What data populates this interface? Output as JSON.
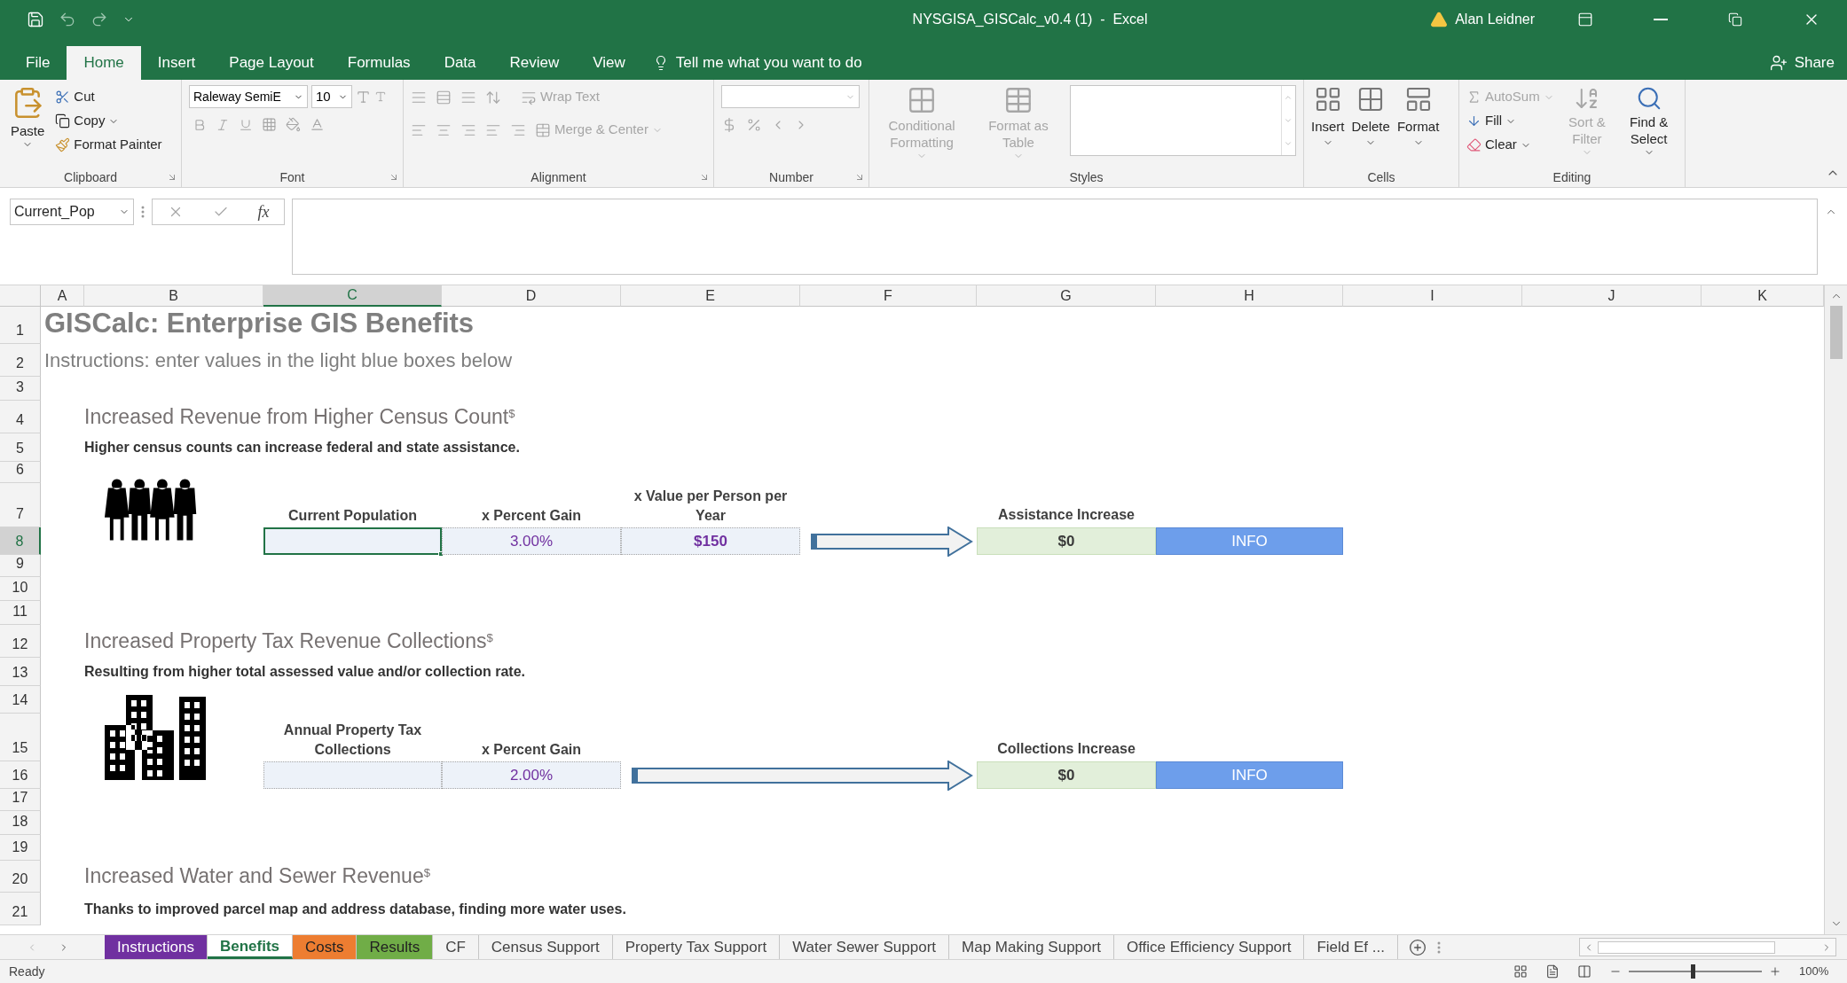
{
  "window": {
    "title": "NYSGISA_GISCalc_v0.4 (1)  -  Excel",
    "user": "Alan Leidner"
  },
  "menu_tabs": [
    {
      "label": "File",
      "selected": false
    },
    {
      "label": "Home",
      "selected": true
    },
    {
      "label": "Insert",
      "selected": false
    },
    {
      "label": "Page Layout",
      "selected": false
    },
    {
      "label": "Formulas",
      "selected": false
    },
    {
      "label": "Data",
      "selected": false
    },
    {
      "label": "Review",
      "selected": false
    },
    {
      "label": "View",
      "selected": false
    }
  ],
  "tell_me": "Tell me what you want to do",
  "share": "Share",
  "ribbon": {
    "clipboard": {
      "label": "Clipboard",
      "paste": "Paste",
      "cut": "Cut",
      "copy": "Copy",
      "format_painter": "Format Painter"
    },
    "font": {
      "label": "Font",
      "font_name": "Raleway SemiE",
      "font_size": "10"
    },
    "alignment": {
      "label": "Alignment",
      "wrap_text": {
        "label": "Wrap Text",
        "disabled": true
      },
      "merge": {
        "label": "Merge & Center",
        "disabled": true
      }
    },
    "number": {
      "label": "Number"
    },
    "styles": {
      "label": "Styles",
      "conditional": {
        "label": "Conditional Formatting",
        "disabled": true
      },
      "format_table": {
        "label": "Format as Table",
        "disabled": true
      }
    },
    "cells": {
      "label": "Cells",
      "buttons": [
        {
          "label": "Insert",
          "disabled": false
        },
        {
          "label": "Delete",
          "disabled": false
        },
        {
          "label": "Format",
          "disabled": false
        }
      ]
    },
    "editing": {
      "label": "Editing",
      "autosum": {
        "label": "AutoSum",
        "disabled": true
      },
      "fill": {
        "label": "Fill",
        "disabled": false
      },
      "clear": {
        "label": "Clear",
        "disabled": false
      },
      "sort": {
        "label": "Sort & Filter",
        "disabled": true
      },
      "find": {
        "label": "Find & Select",
        "disabled": false
      }
    }
  },
  "formula_bar": {
    "name_box": "Current_Pop",
    "function_button": "fx"
  },
  "columns": [
    {
      "label": "A",
      "selected": false
    },
    {
      "label": "B",
      "selected": false
    },
    {
      "label": "C",
      "selected": true
    },
    {
      "label": "D",
      "selected": false
    },
    {
      "label": "E",
      "selected": false
    },
    {
      "label": "F",
      "selected": false
    },
    {
      "label": "G",
      "selected": false
    },
    {
      "label": "H",
      "selected": false
    },
    {
      "label": "I",
      "selected": false
    },
    {
      "label": "J",
      "selected": false
    },
    {
      "label": "K",
      "selected": false
    }
  ],
  "rows": [
    {
      "label": "1",
      "selected": false
    },
    {
      "label": "2",
      "selected": false
    },
    {
      "label": "3",
      "selected": false
    },
    {
      "label": "4",
      "selected": false
    },
    {
      "label": "5",
      "selected": false
    },
    {
      "label": "6",
      "selected": false
    },
    {
      "label": "7",
      "selected": false
    },
    {
      "label": "8",
      "selected": true
    },
    {
      "label": "9",
      "selected": false
    },
    {
      "label": "10",
      "selected": false
    },
    {
      "label": "11",
      "selected": false
    },
    {
      "label": "12",
      "selected": false
    },
    {
      "label": "13",
      "selected": false
    },
    {
      "label": "14",
      "selected": false
    },
    {
      "label": "15",
      "selected": false
    },
    {
      "label": "16",
      "selected": false
    },
    {
      "label": "17",
      "selected": false
    },
    {
      "label": "18",
      "selected": false
    },
    {
      "label": "19",
      "selected": false
    },
    {
      "label": "20",
      "selected": false
    },
    {
      "label": "21",
      "selected": false
    }
  ],
  "sheet": {
    "title": "GISCalc: Enterprise GIS Benefits",
    "instructions": "Instructions: enter values in the light blue boxes below",
    "blocks": [
      {
        "kind": "people",
        "heading": "Increased Revenue from Higher Census Count",
        "mark": "$",
        "description": "Higher census counts can increase federal and state assistance.",
        "inputs": [
          {
            "label": "Current Population",
            "selected": true
          },
          {
            "label": "x Percent Gain",
            "value": "3.00%",
            "kind": "percent",
            "selected": false
          },
          {
            "label": "x Value per Person per Year",
            "value": "$150",
            "kind": "currency",
            "selected": false
          }
        ],
        "result": {
          "label": "Assistance Increase",
          "value": "$0"
        },
        "info": "INFO"
      },
      {
        "kind": "buildings",
        "heading": "Increased Property Tax Revenue Collections",
        "mark": "$",
        "description": "Resulting from higher total assessed value and/or collection rate.",
        "inputs": [
          {
            "label": "Annual Property Tax Collections",
            "selected": false
          },
          {
            "label": "x Percent Gain",
            "value": "2.00%",
            "kind": "percent",
            "selected": false
          }
        ],
        "result": {
          "label": "Collections Increase",
          "value": "$0"
        },
        "info": "INFO"
      },
      {
        "heading": "Increased Water and Sewer Revenue",
        "mark": "$",
        "description": "Thanks to improved parcel map and address database, finding more water uses."
      }
    ]
  },
  "sheet_tabs": [
    {
      "label": "Instructions",
      "selected": false,
      "color": "#7030a0"
    },
    {
      "label": "Benefits",
      "selected": true
    },
    {
      "label": "Costs",
      "selected": false,
      "color": "#ed7d31"
    },
    {
      "label": "Results",
      "selected": false,
      "color": "#70ad47"
    },
    {
      "label": "CF",
      "selected": false
    },
    {
      "label": "Census Support",
      "selected": false
    },
    {
      "label": "Property Tax Support",
      "selected": false
    },
    {
      "label": "Water Sewer Support",
      "selected": false
    },
    {
      "label": "Map Making Support",
      "selected": false
    },
    {
      "label": "Office Efficiency Support",
      "selected": false
    },
    {
      "label": "Field Ef ...",
      "selected": false
    }
  ],
  "status": {
    "text": "Ready",
    "zoom": "100%",
    "zoom_slider": {
      "level": 0.5
    }
  }
}
